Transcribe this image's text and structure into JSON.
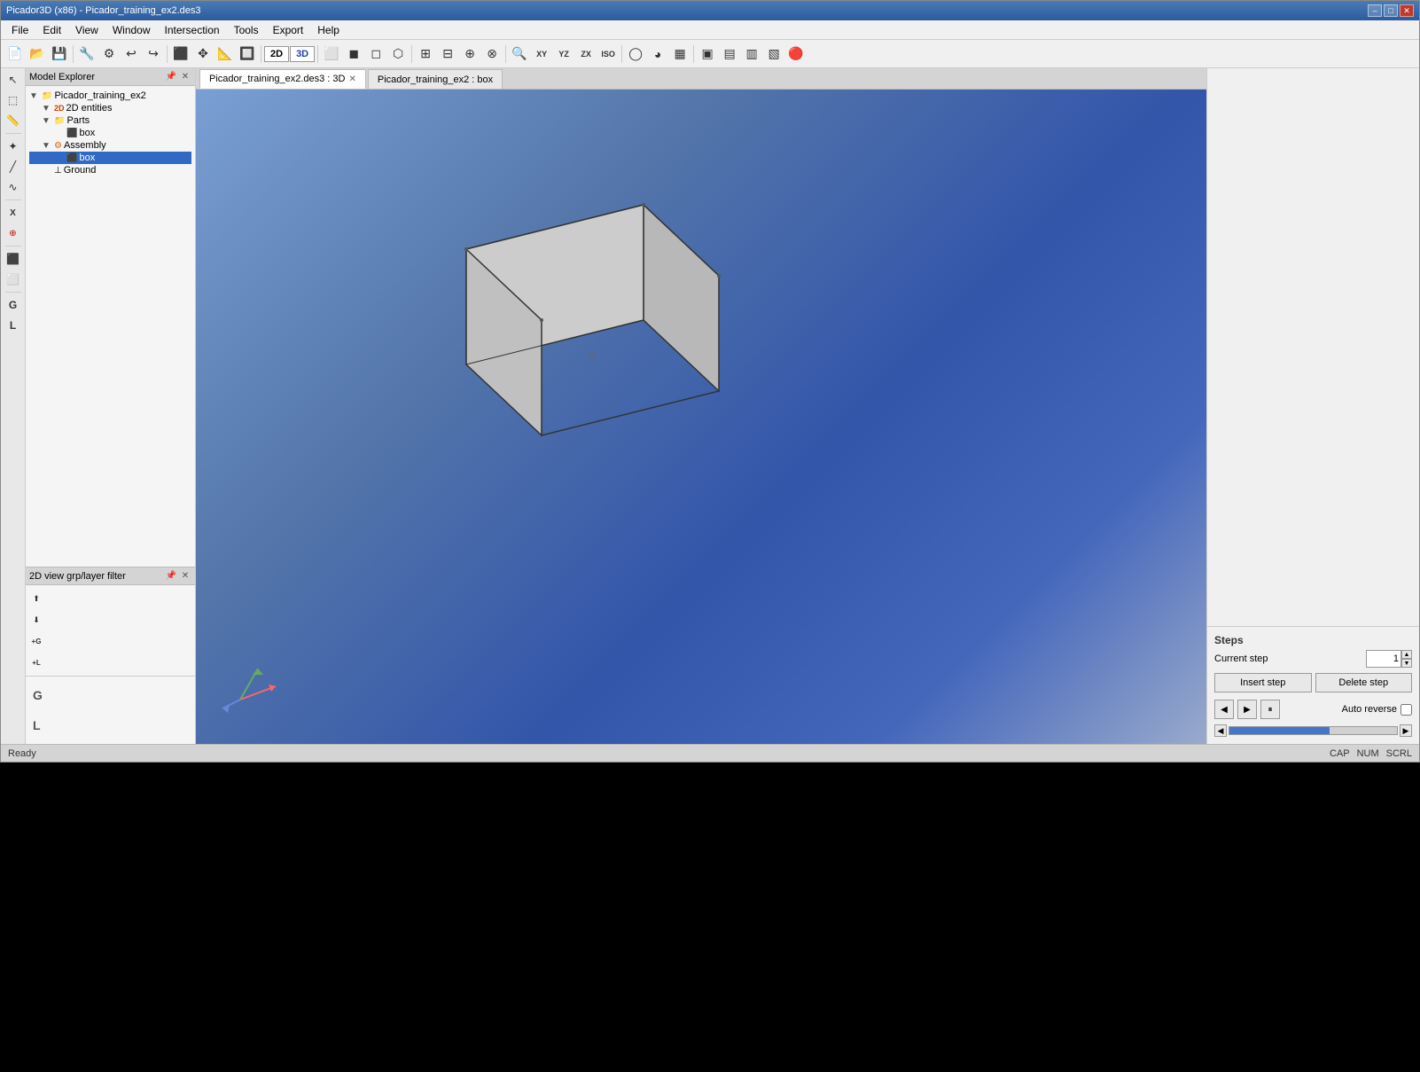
{
  "window": {
    "title": "Picador3D (x86) - Picador_training_ex2.des3",
    "min_label": "–",
    "max_label": "□",
    "close_label": "✕"
  },
  "menu": {
    "items": [
      "File",
      "Edit",
      "View",
      "Window",
      "Intersection",
      "Tools",
      "Export",
      "Help"
    ]
  },
  "toolbar": {
    "btn_2d": "2D",
    "btn_3d": "3D"
  },
  "model_explorer": {
    "title": "Model Explorer",
    "root": "Picador_training_ex2",
    "items": [
      {
        "label": "2D entities",
        "level": 1,
        "icon": "2d",
        "expanded": true
      },
      {
        "label": "Parts",
        "level": 1,
        "icon": "folder",
        "expanded": true
      },
      {
        "label": "box",
        "level": 2,
        "icon": "box"
      },
      {
        "label": "Assembly",
        "level": 1,
        "icon": "assembly",
        "expanded": true
      },
      {
        "label": "box",
        "level": 2,
        "icon": "box",
        "selected": true
      },
      {
        "label": "Ground",
        "level": 1,
        "icon": "ground"
      }
    ]
  },
  "filter_panel": {
    "title": "2D view grp/layer filter"
  },
  "tabs": [
    {
      "label": "Picador_training_ex2.des3 : 3D",
      "active": true,
      "closeable": true
    },
    {
      "label": "Picador_training_ex2 : box",
      "active": false,
      "closeable": false
    }
  ],
  "right_panel": {
    "steps_label": "Steps",
    "current_step_label": "Current step",
    "current_step_value": "1",
    "insert_step_label": "Insert step",
    "delete_step_label": "Delete step",
    "auto_reverse_label": "Auto reverse"
  },
  "status_bar": {
    "status": "Ready",
    "cap": "CAP",
    "num": "NUM",
    "scrl": "SCRL"
  }
}
